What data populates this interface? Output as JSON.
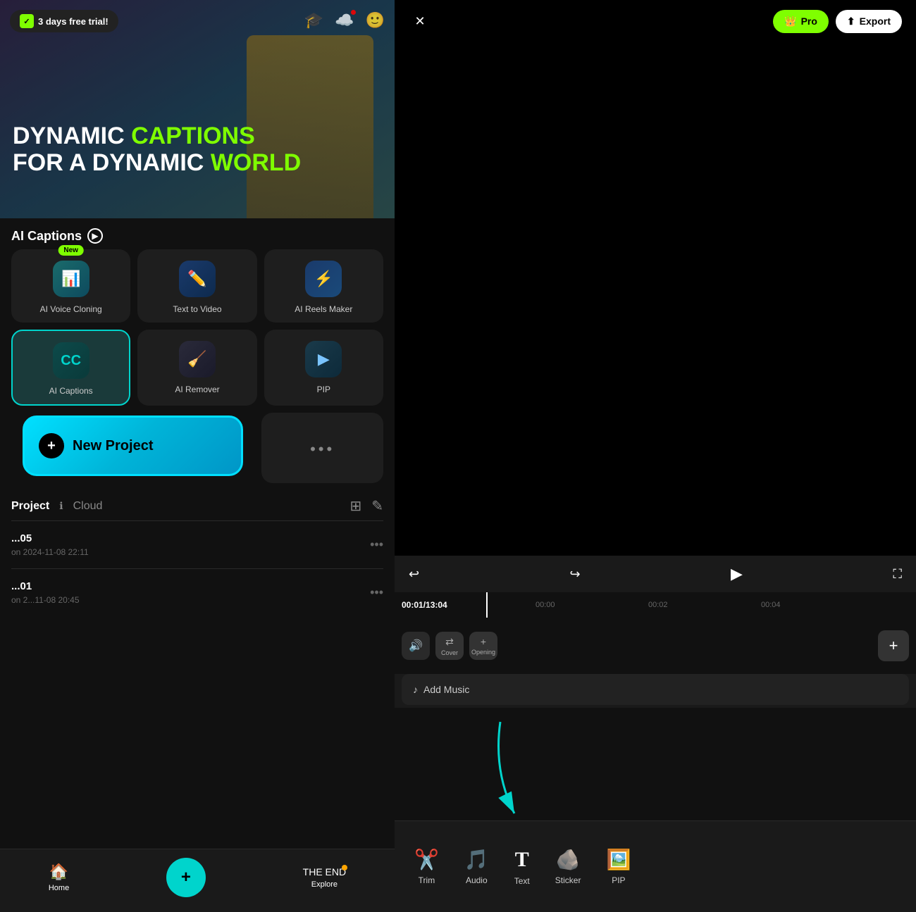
{
  "app": {
    "trial_badge": "3 days free trial!",
    "pro_label": "Pro",
    "export_label": "Export"
  },
  "hero": {
    "line1_white": "DYNAMIC",
    "line1_green": "CAPTIONS",
    "line2_white": "FOR A DYNAMIC",
    "line2_green": "WORLD"
  },
  "ai_captions": {
    "label": "AI Captions"
  },
  "tools": [
    {
      "id": "voice-cloning",
      "label": "AI Voice Cloning",
      "icon": "🎙️",
      "badge": "New",
      "style": "voice"
    },
    {
      "id": "text-to-video",
      "label": "Text  to Video",
      "icon": "✏️",
      "style": "text2vid"
    },
    {
      "id": "reels-maker",
      "label": "AI Reels Maker",
      "icon": "⚡",
      "style": "reels"
    },
    {
      "id": "ai-captions",
      "label": "AI Captions",
      "icon": "CC",
      "style": "captions",
      "active": true
    },
    {
      "id": "ai-remover",
      "label": "AI Remover",
      "icon": "🧹",
      "style": "remover"
    },
    {
      "id": "pip",
      "label": "PIP",
      "icon": "▶️",
      "style": "pip"
    }
  ],
  "new_project": {
    "label": "New Project",
    "icon": "+"
  },
  "more": {
    "dots": "•••"
  },
  "project": {
    "tab_project": "Project",
    "tab_cloud": "Cloud",
    "items": [
      {
        "name": "...05",
        "date": "on 2024-11-08 22:11"
      },
      {
        "name": "...01",
        "date": "on 2...11-08 20:45"
      }
    ]
  },
  "nav": {
    "home": "Home",
    "center": "+",
    "explore": "Explore"
  },
  "timeline": {
    "current_time": "00:01",
    "total_time": "13:04",
    "markers": [
      "00:00",
      "00:02",
      "00:04"
    ],
    "cover_label": "Cover",
    "opening_label": "Opening",
    "add_music": "Add Music"
  },
  "toolbar": {
    "items": [
      {
        "id": "trim",
        "label": "Trim",
        "icon": "✂️"
      },
      {
        "id": "audio",
        "label": "Audio",
        "icon": "🎵"
      },
      {
        "id": "text",
        "label": "Text",
        "icon": "T"
      },
      {
        "id": "sticker",
        "label": "Sticker",
        "icon": "🪨"
      },
      {
        "id": "pip",
        "label": "PIP",
        "icon": "🖼️"
      }
    ]
  }
}
